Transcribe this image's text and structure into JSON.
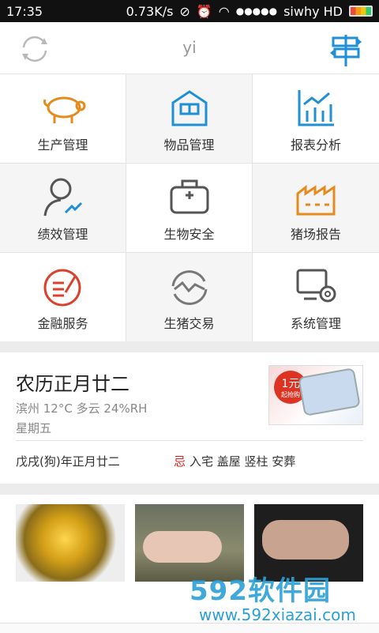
{
  "statusbar": {
    "time": "17:35",
    "speed": "0.73K/s",
    "signal_dots": "●●●●●",
    "carrier": "siwhy HD"
  },
  "topbar": {
    "title": "yi",
    "refresh_icon": "refresh-icon",
    "menu_icon": "signpost-icon",
    "accent": "#1f8fd6"
  },
  "modules": [
    {
      "label": "生产管理",
      "icon": "pig-icon",
      "color": "#e68a1c"
    },
    {
      "label": "物品管理",
      "icon": "warehouse-icon",
      "color": "#1f8fd6"
    },
    {
      "label": "报表分析",
      "icon": "chart-icon",
      "color": "#1f8fd6"
    },
    {
      "label": "绩效管理",
      "icon": "user-performance-icon",
      "color": "#555555"
    },
    {
      "label": "生物安全",
      "icon": "medical-kit-icon",
      "color": "#555555"
    },
    {
      "label": "猪场报告",
      "icon": "factory-icon",
      "color": "#e68a1c"
    },
    {
      "label": "金融服务",
      "icon": "finance-icon",
      "color": "#d9412c"
    },
    {
      "label": "生猪交易",
      "icon": "trade-icon",
      "color": "#777777"
    },
    {
      "label": "系统管理",
      "icon": "settings-screen-icon",
      "color": "#555555"
    }
  ],
  "calendar": {
    "lunar_date": "农历正月廿二",
    "weather": "滨州 12°C 多云 24%RH",
    "weekday": "星期五",
    "ganzhi": "戊戌(狗)年正月廿二",
    "avoid_label": "忌",
    "avoid_items": "入宅 盖屋 竖柱 安葬"
  },
  "ad": {
    "price": "1元",
    "sub": "起抢购"
  },
  "watermark": {
    "brand": "592软件园",
    "url": "www.592xiazai.com"
  }
}
